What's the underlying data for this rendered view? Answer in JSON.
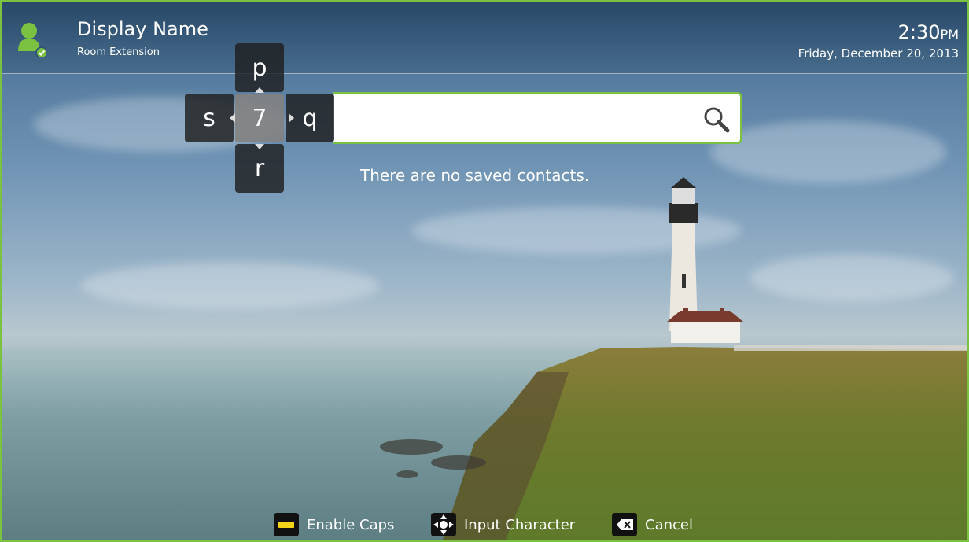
{
  "header": {
    "display_name": "Display Name",
    "room_extension": "Room Extension",
    "time": "2:30",
    "ampm": "PM",
    "date": "Friday, December 20, 2013"
  },
  "search": {
    "value": "",
    "icon": "search-icon"
  },
  "keypad": {
    "center": "7",
    "up": "p",
    "left": "s",
    "right": "q",
    "down": "r"
  },
  "contacts": {
    "empty_message": "There are no saved contacts."
  },
  "footer": {
    "hints": [
      {
        "label": "Enable Caps",
        "icon": "yellow-button-icon"
      },
      {
        "label": "Input Character",
        "icon": "dpad-icon"
      },
      {
        "label": "Cancel",
        "icon": "backspace-icon"
      }
    ]
  },
  "colors": {
    "accent": "#7cc242",
    "caps_key": "#f5d21a"
  }
}
